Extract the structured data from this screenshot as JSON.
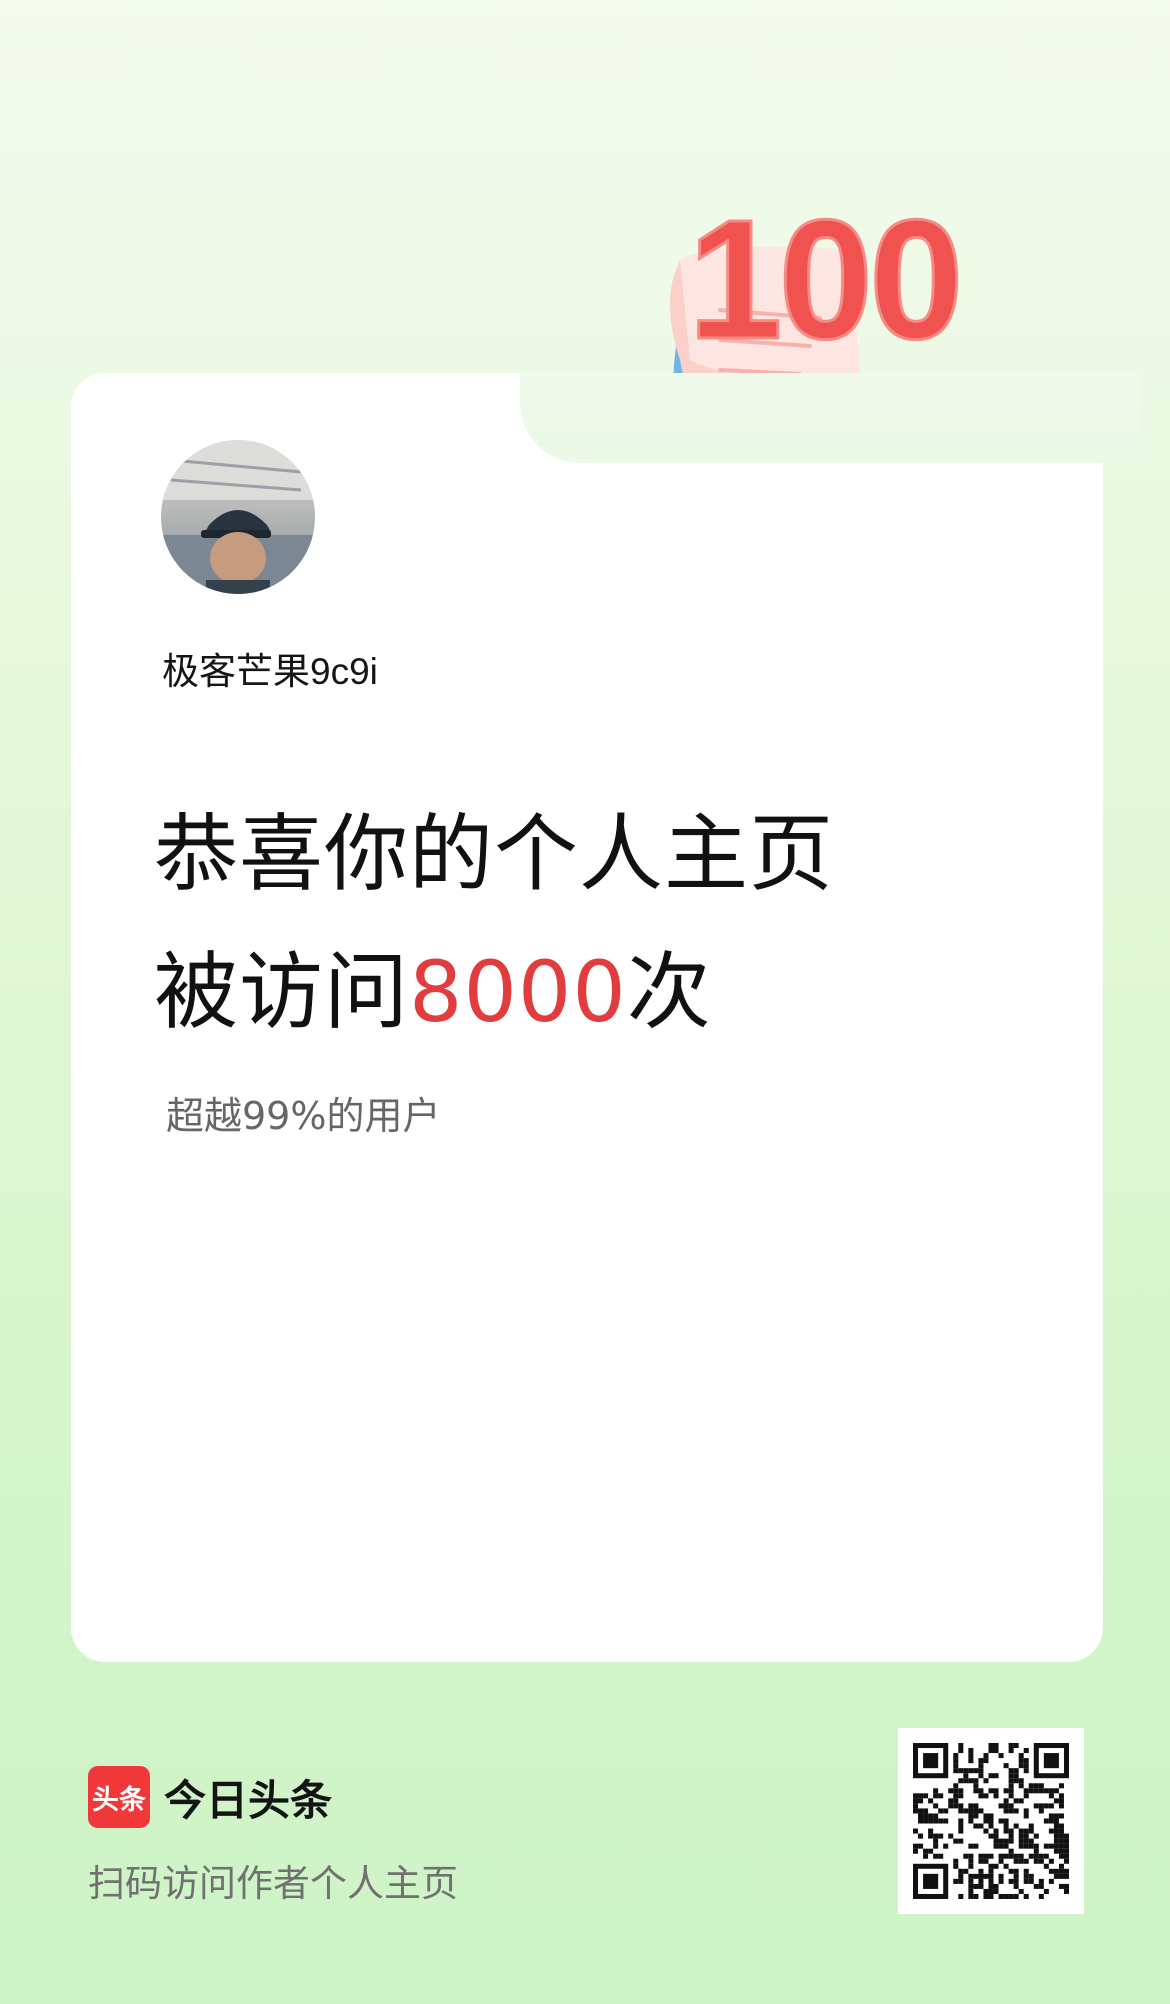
{
  "badge": {
    "number": "100"
  },
  "profile": {
    "username": "极客芒果9c9i"
  },
  "headline": {
    "line1": "恭喜你的个人主页",
    "line2_prefix": "被访问",
    "visits": "8000",
    "line2_suffix": "次"
  },
  "subline": "超越99%的用户",
  "footer": {
    "logo_text": "头条",
    "brand_name": "今日头条",
    "scan_tip": "扫码访问作者个人主页"
  },
  "colors": {
    "accent": "#e23d3e",
    "brand": "#f0383b"
  }
}
